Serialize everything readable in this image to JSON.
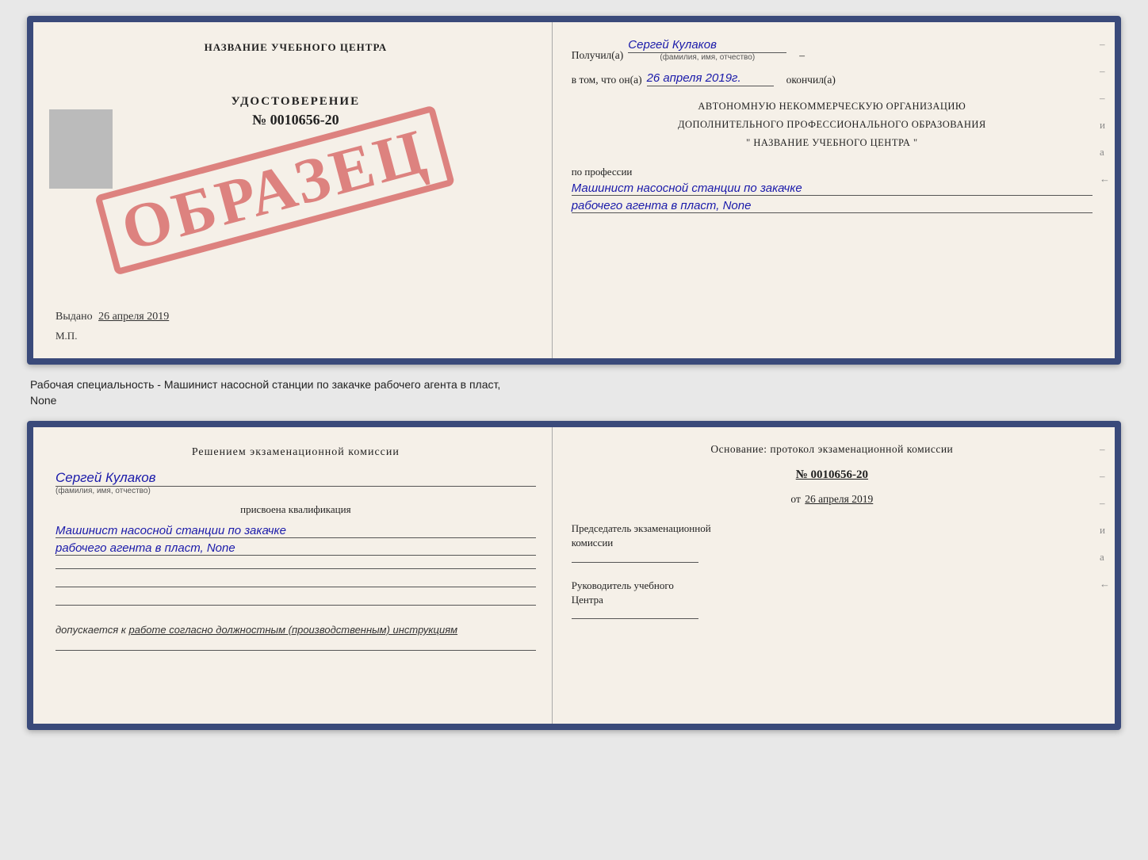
{
  "top_doc": {
    "left": {
      "center_title": "НАЗВАНИЕ УЧЕБНОГО ЦЕНТРА",
      "stamp": "ОБРАЗЕЦ",
      "udostoverenie_label": "УДОСТОВЕРЕНИЕ",
      "udostoverenie_num": "№ 0010656-20",
      "vydano_label": "Выдано",
      "vydano_date": "26 апреля 2019",
      "mp_label": "М.П."
    },
    "right": {
      "poluchil_label": "Получил(а)",
      "poluchil_value": "Сергей Кулаков",
      "familiya_hint": "(фамилия, имя, отчество)",
      "vtom_label": "в том, что он(а)",
      "vtom_date": "26 апреля 2019г.",
      "okончил_label": "окончил(а)",
      "block_line1": "АВТОНОМНУЮ НЕКОММЕРЧЕСКУЮ ОРГАНИЗАЦИЮ",
      "block_line2": "ДОПОЛНИТЕЛЬНОГО ПРОФЕССИОНАЛЬНОГО ОБРАЗОВАНИЯ",
      "block_line3": "\"  НАЗВАНИЕ УЧЕБНОГО ЦЕНТРА  \"",
      "po_professii_label": "по профессии",
      "profession_line1": "Машинист насосной станции по закачке",
      "profession_line2": "рабочего агента в пласт, None",
      "dash1": "–",
      "dash2": "–",
      "dash3": "–",
      "dash_i": "и",
      "dash_a": "а",
      "dash_arrow": "←"
    }
  },
  "separator": {
    "text_line1": "Рабочая специальность - Машинист насосной станции по закачке рабочего агента в пласт,",
    "text_line2": "None"
  },
  "bottom_doc": {
    "left": {
      "komissia_text": "Решением экзаменационной комиссии",
      "person_name": "Сергей Кулаков",
      "familiya_hint": "(фамилия, имя, отчество)",
      "prisvoena_label": "присвоена квалификация",
      "profession_line1": "Машинист насосной станции по закачке",
      "profession_line2": "рабочего агента в пласт, None",
      "line1": "",
      "line2": "",
      "line3": "",
      "dopuskaetsya_label": "допускается к",
      "dopuskaetsya_value": "работе согласно должностным (производственным) инструкциям",
      "line4": ""
    },
    "right": {
      "osnovaniye_text": "Основание: протокол экзаменационной комиссии",
      "protocol_num": "№ 0010656-20",
      "ot_label": "от",
      "ot_date": "26 апреля 2019",
      "predsedatel_label": "Председатель экзаменационной",
      "komissia_label2": "комиссии",
      "rukovoditel_label": "Руководитель учебного",
      "centr_label": "Центра",
      "dash1": "–",
      "dash2": "–",
      "dash3": "–",
      "dash_i": "и",
      "dash_a": "а",
      "dash_arrow": "←"
    }
  }
}
